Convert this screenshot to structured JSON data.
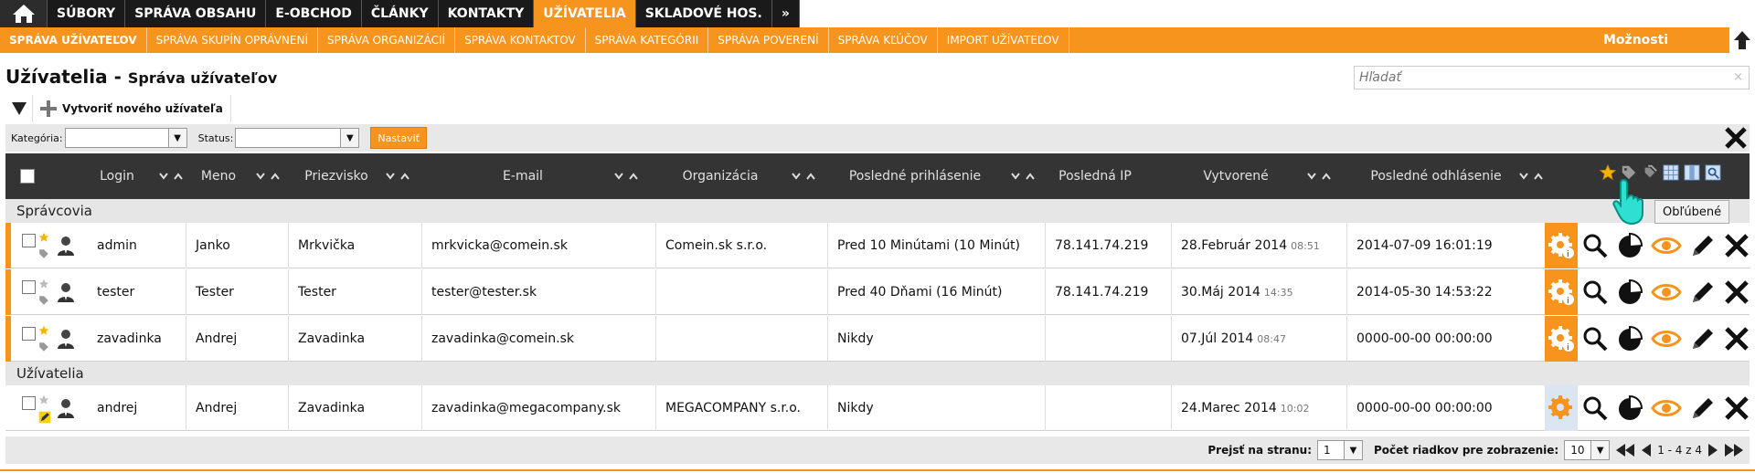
{
  "top_menu": {
    "items": [
      {
        "label": "SÚBORY",
        "active": false
      },
      {
        "label": "SPRÁVA OBSAHU",
        "active": false
      },
      {
        "label": "E-OBCHOD",
        "active": false
      },
      {
        "label": "ČLÁNKY",
        "active": false
      },
      {
        "label": "KONTAKTY",
        "active": false
      },
      {
        "label": "UŽÍVATELIA",
        "active": true
      },
      {
        "label": "SKLADOVÉ HOS.",
        "active": false
      }
    ],
    "more_label": "»"
  },
  "sub_menu": {
    "items": [
      {
        "label": "SPRÁVA UŽÍVATEĽOV",
        "active": true
      },
      {
        "label": "SPRÁVA SKUPÍN OPRÁVNENÍ",
        "active": false
      },
      {
        "label": "SPRÁVA ORGANIZÁCIÍ",
        "active": false
      },
      {
        "label": "SPRÁVA KONTAKTOV",
        "active": false
      },
      {
        "label": "SPRÁVA KATEGÓRII",
        "active": false
      },
      {
        "label": "SPRÁVA POVERENÍ",
        "active": false
      },
      {
        "label": "SPRÁVA KĽÚČOV",
        "active": false
      },
      {
        "label": "IMPORT UŽÍVATEĽOV",
        "active": false
      }
    ],
    "options_label": "Možnosti"
  },
  "page": {
    "title": "Užívatelia -",
    "subtitle": "Správa užívateľov"
  },
  "search": {
    "placeholder": "Hľadať",
    "clear": "×"
  },
  "toolbar": {
    "create_label": "Vytvoriť nového užívateľa"
  },
  "filters": {
    "category_label": "Kategória:",
    "status_label": "Status:",
    "set_label": "Nastaviť"
  },
  "table": {
    "columns": {
      "login": "Login",
      "name": "Meno",
      "surname": "Priezvisko",
      "email": "E-mail",
      "org": "Organizácia",
      "last_login": "Posledné prihlásenie",
      "last_ip": "Posledná IP",
      "created": "Vytvorené",
      "last_logout": "Posledné odhlásenie"
    },
    "groups": [
      {
        "label": "Správcovia",
        "rows": [
          {
            "login": "admin",
            "name": "Janko",
            "surname": "Mrkvička",
            "email": "mrkvicka@comein.sk",
            "org": "Comein.sk s.r.o.",
            "last_login": "Pred 10 Minútami (10 Minút)",
            "last_ip": "78.141.74.219",
            "created_date": "28.Február 2014",
            "created_time": "08:51",
            "last_logout": "2014-07-09 16:01:19",
            "favorite": true
          },
          {
            "login": "tester",
            "name": "Tester",
            "surname": "Tester",
            "email": "tester@tester.sk",
            "org": "",
            "last_login": "Pred 40 Dňami (16 Minút)",
            "last_ip": "78.141.74.219",
            "created_date": "30.Máj 2014",
            "created_time": "14:35",
            "last_logout": "2014-05-30 14:53:22",
            "favorite": false
          },
          {
            "login": "zavadinka",
            "name": "Andrej",
            "surname": "Zavadinka",
            "email": "zavadinka@comein.sk",
            "org": "",
            "last_login": "Nikdy",
            "last_ip": "",
            "created_date": "07.Júl 2014",
            "created_time": "08:47",
            "last_logout": "0000-00-00 00:00:00",
            "favorite": true
          }
        ]
      },
      {
        "label": "Užívatelia",
        "rows": [
          {
            "login": "andrej",
            "name": "Andrej",
            "surname": "Zavadinka",
            "email": "zavadinka@megacompany.sk",
            "org": "MEGACOMPANY s.r.o.",
            "last_login": "Nikdy",
            "last_ip": "",
            "created_date": "24.Marec 2014",
            "created_time": "10:02",
            "last_logout": "0000-00-00 00:00:00",
            "favorite": false
          }
        ]
      }
    ]
  },
  "tooltip": {
    "text": "Obľúbené"
  },
  "pager": {
    "goto_label": "Prejsť na stranu:",
    "page_value": "1",
    "rows_label": "Počet riadkov pre zobrazenie:",
    "rows_value": "10",
    "range": "1 - 4 z 4"
  },
  "colors": {
    "accent": "#f7941d",
    "dark": "#1a1a1a",
    "header": "#343434"
  }
}
